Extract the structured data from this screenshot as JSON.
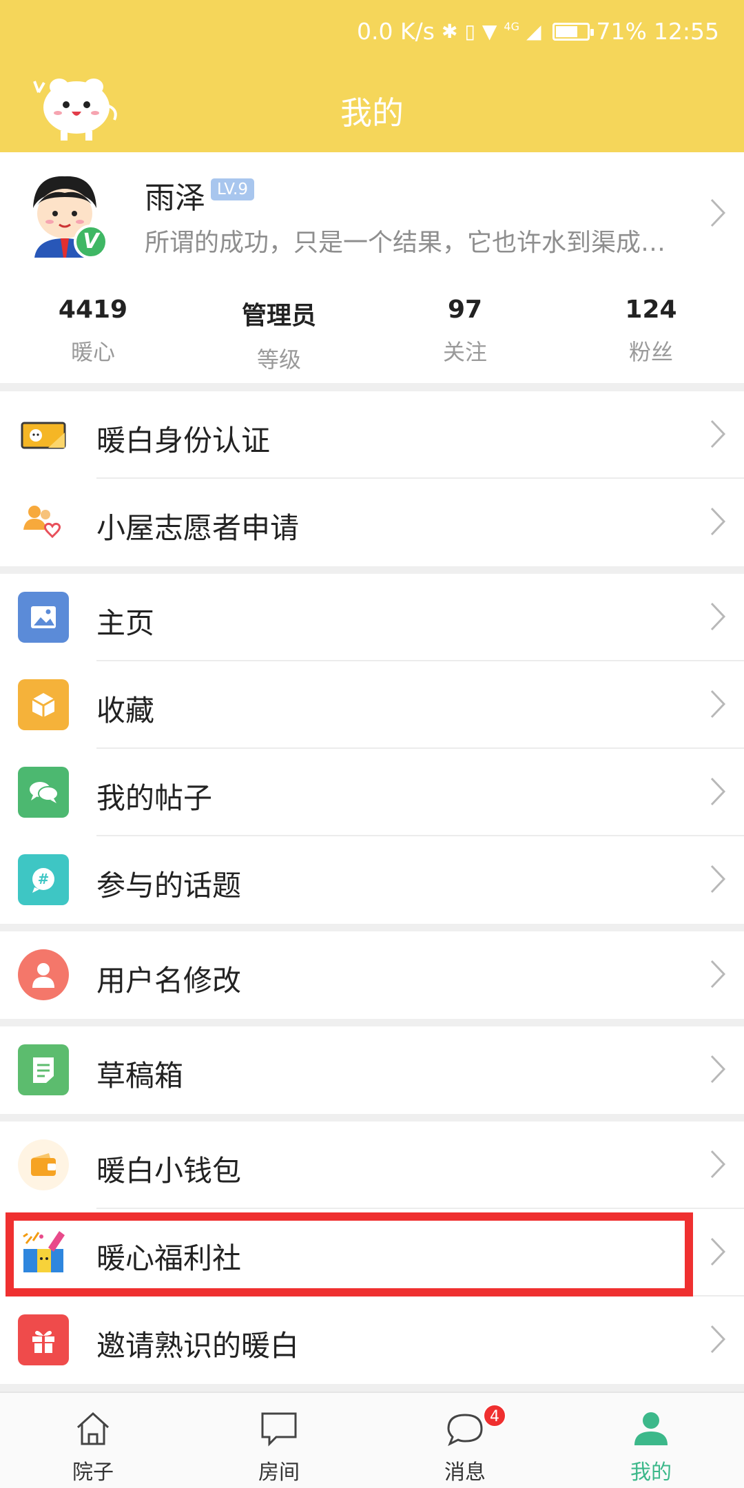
{
  "status_bar": {
    "speed": "0.0 K/s",
    "network": "4G",
    "battery_percent": 71,
    "battery_text": "71%",
    "time": "12:55"
  },
  "header": {
    "title": "我的",
    "mascot_icon": "mascot-icon"
  },
  "profile": {
    "name": "雨泽",
    "level": "LV.9",
    "verified_badge": "V",
    "signature": "所谓的成功，只是一个结果，它也许水到渠成…",
    "stats": [
      {
        "value": "4419",
        "label": "暖心"
      },
      {
        "value": "管理员",
        "label": "等级"
      },
      {
        "value": "97",
        "label": "关注"
      },
      {
        "value": "124",
        "label": "粉丝"
      }
    ]
  },
  "menu": [
    {
      "label": "暖白身份认证",
      "icon": "id-card-icon"
    },
    {
      "label": "小屋志愿者申请",
      "icon": "volunteer-heart-icon"
    },
    {
      "label": "主页",
      "icon": "homepage-image-icon",
      "color": "#5b8bd8"
    },
    {
      "label": "收藏",
      "icon": "box-icon",
      "color": "#f5b23a"
    },
    {
      "label": "我的帖子",
      "icon": "chat-bubbles-icon",
      "color": "#4cb870"
    },
    {
      "label": "参与的话题",
      "icon": "hashtag-bubble-icon",
      "color": "#3ec6c4"
    },
    {
      "label": "用户名修改",
      "icon": "user-icon",
      "color": "#f4776a"
    },
    {
      "label": "草稿箱",
      "icon": "document-icon",
      "color": "#5cbc6e"
    },
    {
      "label": "暖白小钱包",
      "icon": "wallet-icon",
      "color": "#f6a323"
    },
    {
      "label": "暖心福利社",
      "icon": "gift-shop-icon"
    },
    {
      "label": "邀请熟识的暖白",
      "icon": "gift-icon",
      "color": "#ef4b4b"
    }
  ],
  "tabs": [
    {
      "label": "院子",
      "icon": "house-icon"
    },
    {
      "label": "房间",
      "icon": "chat-square-icon"
    },
    {
      "label": "消息",
      "icon": "message-bubble-icon",
      "badge": "4"
    },
    {
      "label": "我的",
      "icon": "person-icon",
      "active": true
    }
  ],
  "colors": {
    "header_bg": "#f5d65a",
    "accent_green": "#3cb88a",
    "highlight_red": "#ef3030"
  }
}
